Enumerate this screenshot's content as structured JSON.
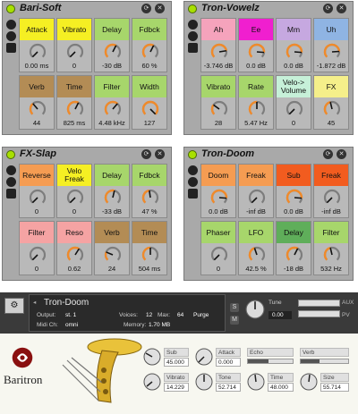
{
  "racks": [
    {
      "title": "Bari-Soft",
      "macros": [
        {
          "label": "Attack",
          "value": "0.00 ms",
          "color": "#f5ef23",
          "level": 0.0
        },
        {
          "label": "Vibrato",
          "value": "0",
          "color": "#f5ef23",
          "level": 0.0
        },
        {
          "label": "Delay",
          "value": "-30 dB",
          "color": "#a7d66b",
          "level": 0.6
        },
        {
          "label": "Fdbck",
          "value": "60 %",
          "color": "#a7d66b",
          "level": 0.6
        },
        {
          "label": "Verb",
          "value": "44",
          "color": "#b38c55",
          "level": 0.35
        },
        {
          "label": "Time",
          "value": "825 ms",
          "color": "#b38c55",
          "level": 0.6
        },
        {
          "label": "Filter",
          "value": "4.48 kHz",
          "color": "#a7d66b",
          "level": 0.65
        },
        {
          "label": "Width",
          "value": "127",
          "color": "#a7d66b",
          "level": 1.0
        }
      ]
    },
    {
      "title": "Tron-Vowelz",
      "macros": [
        {
          "label": "Ah",
          "value": "-3.746 dB",
          "color": "#f5a3bc",
          "level": 0.8
        },
        {
          "label": "Ee",
          "value": "0.0 dB",
          "color": "#f01fcf",
          "level": 0.85
        },
        {
          "label": "Mm",
          "value": "0.0 dB",
          "color": "#c6a8e0",
          "level": 0.85
        },
        {
          "label": "Uh",
          "value": "-1.872 dB",
          "color": "#8fb4e3",
          "level": 0.82
        },
        {
          "label": "Vibrato",
          "value": "28",
          "color": "#a7d66b",
          "level": 0.3
        },
        {
          "label": "Rate",
          "value": "5.47 Hz",
          "color": "#a7d66b",
          "level": 0.5
        },
        {
          "label": "Velo->\nVolume",
          "value": "0",
          "color": "#c6f0d8",
          "level": 0.0
        },
        {
          "label": "FX",
          "value": "45",
          "color": "#f5ef8a",
          "level": 0.45
        }
      ]
    },
    {
      "title": "FX-Slap",
      "macros": [
        {
          "label": "Reverse",
          "value": "0",
          "color": "#f59c52",
          "level": 0.0
        },
        {
          "label": "Velo\nFreak",
          "value": "0",
          "color": "#f5ef23",
          "level": 0.0
        },
        {
          "label": "Delay",
          "value": "-33 dB",
          "color": "#a7d66b",
          "level": 0.55
        },
        {
          "label": "Fdbck",
          "value": "47 %",
          "color": "#a7d66b",
          "level": 0.47
        },
        {
          "label": "Filter",
          "value": "0",
          "color": "#f5a3a3",
          "level": 0.0
        },
        {
          "label": "Reso",
          "value": "0.62",
          "color": "#f5a3a3",
          "level": 0.62
        },
        {
          "label": "Verb",
          "value": "24",
          "color": "#b38c55",
          "level": 0.25
        },
        {
          "label": "Time",
          "value": "504 ms",
          "color": "#b38c55",
          "level": 0.5
        }
      ]
    },
    {
      "title": "Tron-Doom",
      "macros": [
        {
          "label": "Doom",
          "value": "0.0 dB",
          "color": "#f59c52",
          "level": 0.85
        },
        {
          "label": "Freak",
          "value": "-inf dB",
          "color": "#f59c52",
          "level": 0.0
        },
        {
          "label": "Sub",
          "value": "0.0 dB",
          "color": "#f25c1f",
          "level": 0.85
        },
        {
          "label": "Freak",
          "value": "-inf dB",
          "color": "#f25c1f",
          "level": 0.0
        },
        {
          "label": "Phaser",
          "value": "0",
          "color": "#a7d66b",
          "level": 0.0
        },
        {
          "label": "LFO",
          "value": "42.5 %",
          "color": "#a7d66b",
          "level": 0.43
        },
        {
          "label": "Delay",
          "value": "-18 dB",
          "color": "#5fae5a",
          "level": 0.6
        },
        {
          "label": "Filter",
          "value": "532 Hz",
          "color": "#a7d66b",
          "level": 0.45
        }
      ]
    }
  ],
  "kontakt": {
    "instrument_name": "Tron-Doom",
    "output_label": "Output:",
    "output_value": "st. 1",
    "voices_label": "Voices:",
    "voices_value": "12",
    "max_label": "Max:",
    "max_value": "64",
    "purge_label": "Purge",
    "midi_label": "Midi Ch:",
    "midi_value": "omni",
    "memory_label": "Memory:",
    "memory_value": "1.70 MB",
    "tune_label": "Tune",
    "tune_value": "0.00",
    "s_label": "S",
    "m_label": "M",
    "aux_label": "AUX",
    "pv_label": "PV"
  },
  "baritron": {
    "logo_text": "Baritron",
    "controls": [
      {
        "label": "Sub",
        "value": "45.000"
      },
      {
        "label": "Vibrato",
        "value": "14.229"
      },
      {
        "label": "Attack",
        "value": "0.000"
      },
      {
        "label": "Tone",
        "value": "52.714"
      },
      {
        "label": "Echo",
        "value": ""
      },
      {
        "label": "Time",
        "value": "48.000"
      },
      {
        "label": "Verb",
        "value": ""
      },
      {
        "label": "Size",
        "value": "55.714"
      }
    ]
  }
}
